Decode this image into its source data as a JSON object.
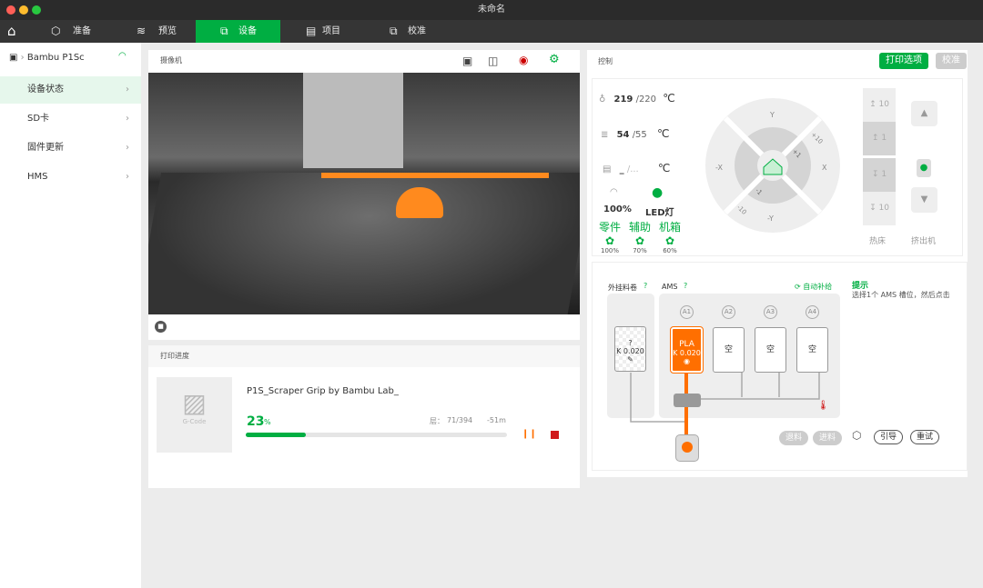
{
  "window": {
    "title": "未命名"
  },
  "tabs": [
    {
      "label": "准备",
      "icon": "cube-icon"
    },
    {
      "label": "预览",
      "icon": "layers-icon"
    },
    {
      "label": "设备",
      "icon": "device-icon",
      "active": true
    },
    {
      "label": "项目",
      "icon": "project-icon"
    },
    {
      "label": "校准",
      "icon": "calibrate-icon"
    }
  ],
  "sidebar": {
    "printer": "Bambu P1Sc",
    "items": [
      {
        "label": "设备状态",
        "active": true
      },
      {
        "label": "SD卡"
      },
      {
        "label": "固件更新"
      },
      {
        "label": "HMS"
      }
    ]
  },
  "camera": {
    "title": "摄像机"
  },
  "progress": {
    "title": "打印进度",
    "file": "P1S_Scraper Grip by Bambu Lab_",
    "percent": 23,
    "percent_text": "23",
    "percent_unit": "%",
    "layer_label": "层：",
    "layer": "71/394",
    "remaining": "-51m",
    "thumb_label": "G-Code"
  },
  "control": {
    "title": "控制",
    "print_options": "打印选项",
    "calibrate": "校准",
    "nozzle": {
      "current": "219",
      "target": "/220",
      "unit": "℃"
    },
    "bed": {
      "current": "54",
      "target": "/55",
      "unit": "℃"
    },
    "chamber": {
      "current": "_",
      "target": "/...",
      "unit": "℃"
    },
    "speed": "100%",
    "led": "LED灯",
    "fans": [
      {
        "label": "零件",
        "value": "100%"
      },
      {
        "label": "辅助",
        "value": "70%"
      },
      {
        "label": "机箱",
        "value": "60%"
      }
    ],
    "jog": {
      "y": "Y",
      "ny": "-Y",
      "x": "X",
      "nx": "-X",
      "p10": "+10",
      "p1": "+1",
      "n1": "-1",
      "n10": "-10"
    },
    "bed_z": [
      "10",
      "1",
      "1",
      "10"
    ],
    "bed_label": "热床",
    "extruder_label": "挤出机"
  },
  "ams": {
    "external_label": "外挂料卷",
    "ams_label": "AMS",
    "auto_refill": "自动补给",
    "hint_title": "提示",
    "hint_text": "选择1个 AMS 槽位，然后点击",
    "external": {
      "type": "?",
      "k": "K 0.020"
    },
    "slots": [
      {
        "id": "A1",
        "type": "PLA",
        "k": "K 0.020",
        "color": "#ff6f00"
      },
      {
        "id": "A2",
        "type": "空"
      },
      {
        "id": "A3",
        "type": "空"
      },
      {
        "id": "A4",
        "type": "空"
      }
    ],
    "unload": "退料",
    "load": "进料",
    "guide": "引导",
    "retry": "重试"
  },
  "accent": "#00ae42"
}
